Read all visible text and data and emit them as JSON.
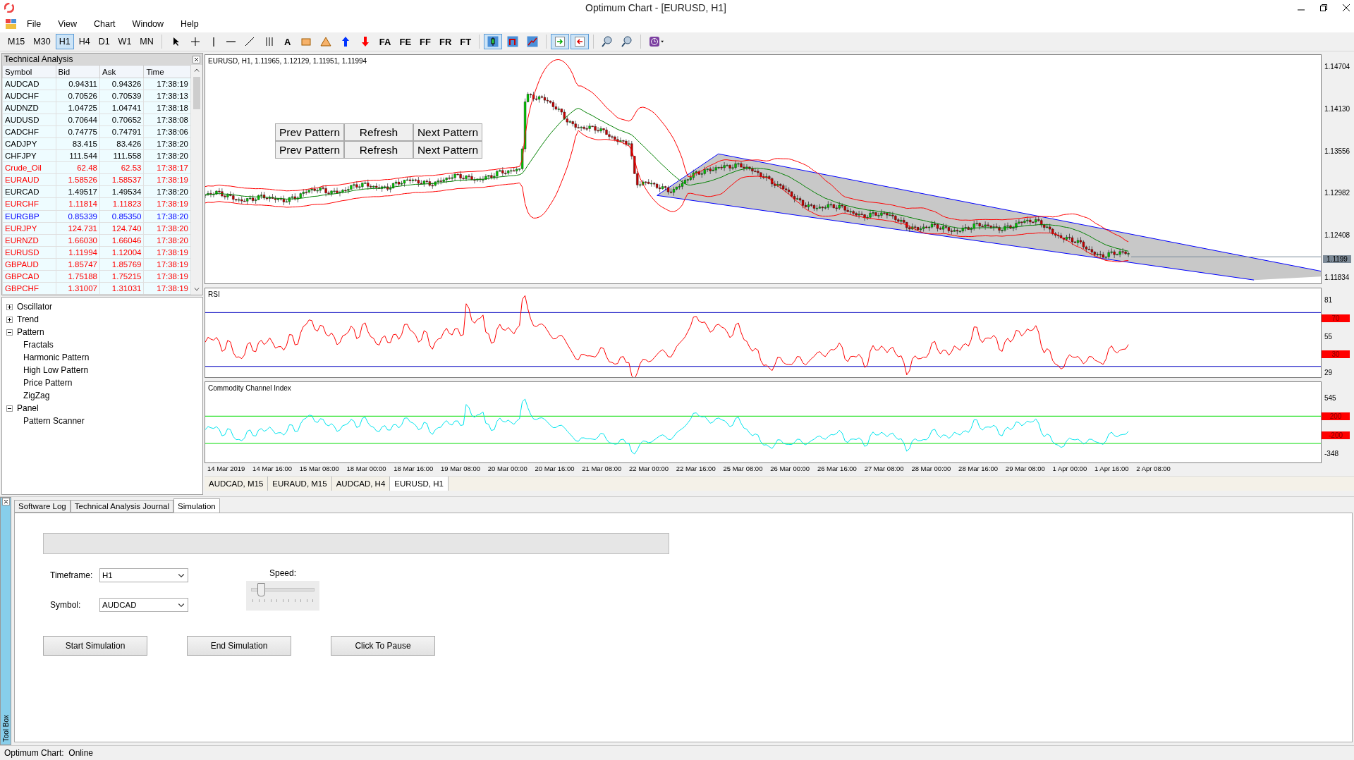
{
  "window": {
    "title": "Optimum Chart - [EURUSD, H1]"
  },
  "menu": [
    "File",
    "View",
    "Chart",
    "Window",
    "Help"
  ],
  "toolbar": {
    "timeframes": [
      {
        "label": "M15",
        "selected": false
      },
      {
        "label": "M30",
        "selected": false
      },
      {
        "label": "H1",
        "selected": true
      },
      {
        "label": "H4",
        "selected": false
      },
      {
        "label": "D1",
        "selected": false
      },
      {
        "label": "W1",
        "selected": false
      },
      {
        "label": "MN",
        "selected": false
      }
    ],
    "tools": [
      {
        "kind": "cursor"
      },
      {
        "kind": "crosshair"
      },
      {
        "kind": "vline"
      },
      {
        "kind": "hline"
      },
      {
        "kind": "trendline"
      },
      {
        "kind": "channel"
      },
      {
        "kind": "text",
        "label": "A"
      },
      {
        "kind": "rect"
      },
      {
        "kind": "triangle"
      },
      {
        "kind": "arrow-up"
      },
      {
        "kind": "arrow-down"
      },
      {
        "kind": "text",
        "label": "FA"
      },
      {
        "kind": "text",
        "label": "FE"
      },
      {
        "kind": "text",
        "label": "FF"
      },
      {
        "kind": "text",
        "label": "FR"
      },
      {
        "kind": "text",
        "label": "FT"
      }
    ],
    "chart_types": [
      {
        "kind": "candle",
        "selected": true
      },
      {
        "kind": "bar",
        "selected": false
      },
      {
        "kind": "line",
        "selected": false
      }
    ]
  },
  "market_watch": {
    "title": "Technical Analysis",
    "columns": [
      "Symbol",
      "Bid",
      "Ask",
      "Time"
    ],
    "rows": [
      {
        "cells": [
          "AUDCAD",
          "0.94311",
          "0.94326",
          "17:38:19"
        ],
        "color": "#000000"
      },
      {
        "cells": [
          "AUDCHF",
          "0.70526",
          "0.70539",
          "17:38:13"
        ],
        "color": "#000000"
      },
      {
        "cells": [
          "AUDNZD",
          "1.04725",
          "1.04741",
          "17:38:18"
        ],
        "color": "#000000"
      },
      {
        "cells": [
          "AUDUSD",
          "0.70644",
          "0.70652",
          "17:38:08"
        ],
        "color": "#000000"
      },
      {
        "cells": [
          "CADCHF",
          "0.74775",
          "0.74791",
          "17:38:06"
        ],
        "color": "#000000"
      },
      {
        "cells": [
          "CADJPY",
          "83.415",
          "83.426",
          "17:38:20"
        ],
        "color": "#000000"
      },
      {
        "cells": [
          "CHFJPY",
          "111.544",
          "111.558",
          "17:38:20"
        ],
        "color": "#000000"
      },
      {
        "cells": [
          "Crude_Oil",
          "62.48",
          "62.53",
          "17:38:17"
        ],
        "color": "#ff0000"
      },
      {
        "cells": [
          "EURAUD",
          "1.58526",
          "1.58537",
          "17:38:19"
        ],
        "color": "#ff0000"
      },
      {
        "cells": [
          "EURCAD",
          "1.49517",
          "1.49534",
          "17:38:20"
        ],
        "color": "#000000"
      },
      {
        "cells": [
          "EURCHF",
          "1.11814",
          "1.11823",
          "17:38:19"
        ],
        "color": "#ff0000"
      },
      {
        "cells": [
          "EURGBP",
          "0.85339",
          "0.85350",
          "17:38:20"
        ],
        "color": "#0000ff"
      },
      {
        "cells": [
          "EURJPY",
          "124.731",
          "124.740",
          "17:38:20"
        ],
        "color": "#ff0000"
      },
      {
        "cells": [
          "EURNZD",
          "1.66030",
          "1.66046",
          "17:38:20"
        ],
        "color": "#ff0000"
      },
      {
        "cells": [
          "EURUSD",
          "1.11994",
          "1.12004",
          "17:38:19"
        ],
        "color": "#ff0000"
      },
      {
        "cells": [
          "GBPAUD",
          "1.85747",
          "1.85769",
          "17:38:19"
        ],
        "color": "#ff0000"
      },
      {
        "cells": [
          "GBPCAD",
          "1.75188",
          "1.75215",
          "17:38:19"
        ],
        "color": "#ff0000"
      },
      {
        "cells": [
          "GBPCHF",
          "1.31007",
          "1.31031",
          "17:38:19"
        ],
        "color": "#ff0000"
      }
    ]
  },
  "tree": [
    {
      "label": "Oscillator",
      "expanded": false
    },
    {
      "label": "Trend",
      "expanded": false
    },
    {
      "label": "Pattern",
      "expanded": true,
      "children": [
        {
          "label": "Fractals"
        },
        {
          "label": "Harmonic Pattern"
        },
        {
          "label": "High Low Pattern"
        },
        {
          "label": "Price Pattern"
        },
        {
          "label": "ZigZag"
        }
      ]
    },
    {
      "label": "Panel",
      "expanded": true,
      "children": [
        {
          "label": "Pattern Scanner"
        }
      ]
    }
  ],
  "chart": {
    "info": "EURUSD, H1, 1.11965, 1.12129, 1.11951, 1.11994",
    "pattern_buttons": [
      [
        "Prev Pattern",
        "Refresh",
        "Next Pattern"
      ],
      [
        "Prev Pattern",
        "Refresh",
        "Next Pattern"
      ]
    ],
    "price_axis": [
      "1.14704",
      "1.14130",
      "1.13556",
      "1.12982",
      "1.12408",
      "1.11834"
    ],
    "current_price": "1.1199",
    "rsi": {
      "title": "RSI",
      "axis": [
        {
          "kind": "tick",
          "label": "81"
        },
        {
          "kind": "level",
          "label": "70"
        },
        {
          "kind": "tick",
          "label": "55"
        },
        {
          "kind": "level",
          "label": "30"
        },
        {
          "kind": "tick",
          "label": "29"
        }
      ]
    },
    "cci": {
      "title": "Commodity Channel Index",
      "axis": [
        {
          "kind": "tick",
          "label": "545"
        },
        {
          "kind": "level",
          "label": "200"
        },
        {
          "kind": "level",
          "label": "-200"
        },
        {
          "kind": "tick",
          "label": "-348"
        }
      ]
    },
    "time_axis": [
      "14 Mar 2019",
      "14 Mar 16:00",
      "15 Mar 08:00",
      "18 Mar 00:00",
      "18 Mar 16:00",
      "19 Mar 08:00",
      "20 Mar 00:00",
      "20 Mar 16:00",
      "21 Mar 08:00",
      "22 Mar 00:00",
      "22 Mar 16:00",
      "25 Mar 08:00",
      "26 Mar 00:00",
      "26 Mar 16:00",
      "27 Mar 08:00",
      "28 Mar 00:00",
      "28 Mar 16:00",
      "29 Mar 08:00",
      "1 Apr 00:00",
      "1 Apr 16:00",
      "2 Apr 08:00"
    ],
    "tabs": [
      {
        "label": "AUDCAD, M15",
        "selected": false
      },
      {
        "label": "EURAUD, M15",
        "selected": false
      },
      {
        "label": "AUDCAD, H4",
        "selected": false
      },
      {
        "label": "EURUSD, H1",
        "selected": true
      }
    ]
  },
  "toolbox": {
    "label": "Tool Box",
    "tabs": [
      {
        "label": "Software Log",
        "selected": false
      },
      {
        "label": "Technical Analysis Journal",
        "selected": false
      },
      {
        "label": "Simulation",
        "selected": true
      }
    ],
    "timeframe": {
      "label": "Timeframe:",
      "value": "H1"
    },
    "symbol": {
      "label": "Symbol:",
      "value": "AUDCAD"
    },
    "speed": {
      "label": "Speed:",
      "level": 0.15
    },
    "buttons": [
      "Start Simulation",
      "End Simulation",
      "Click To Pause"
    ]
  },
  "status_bar": "Optimum Chart:  Online"
}
